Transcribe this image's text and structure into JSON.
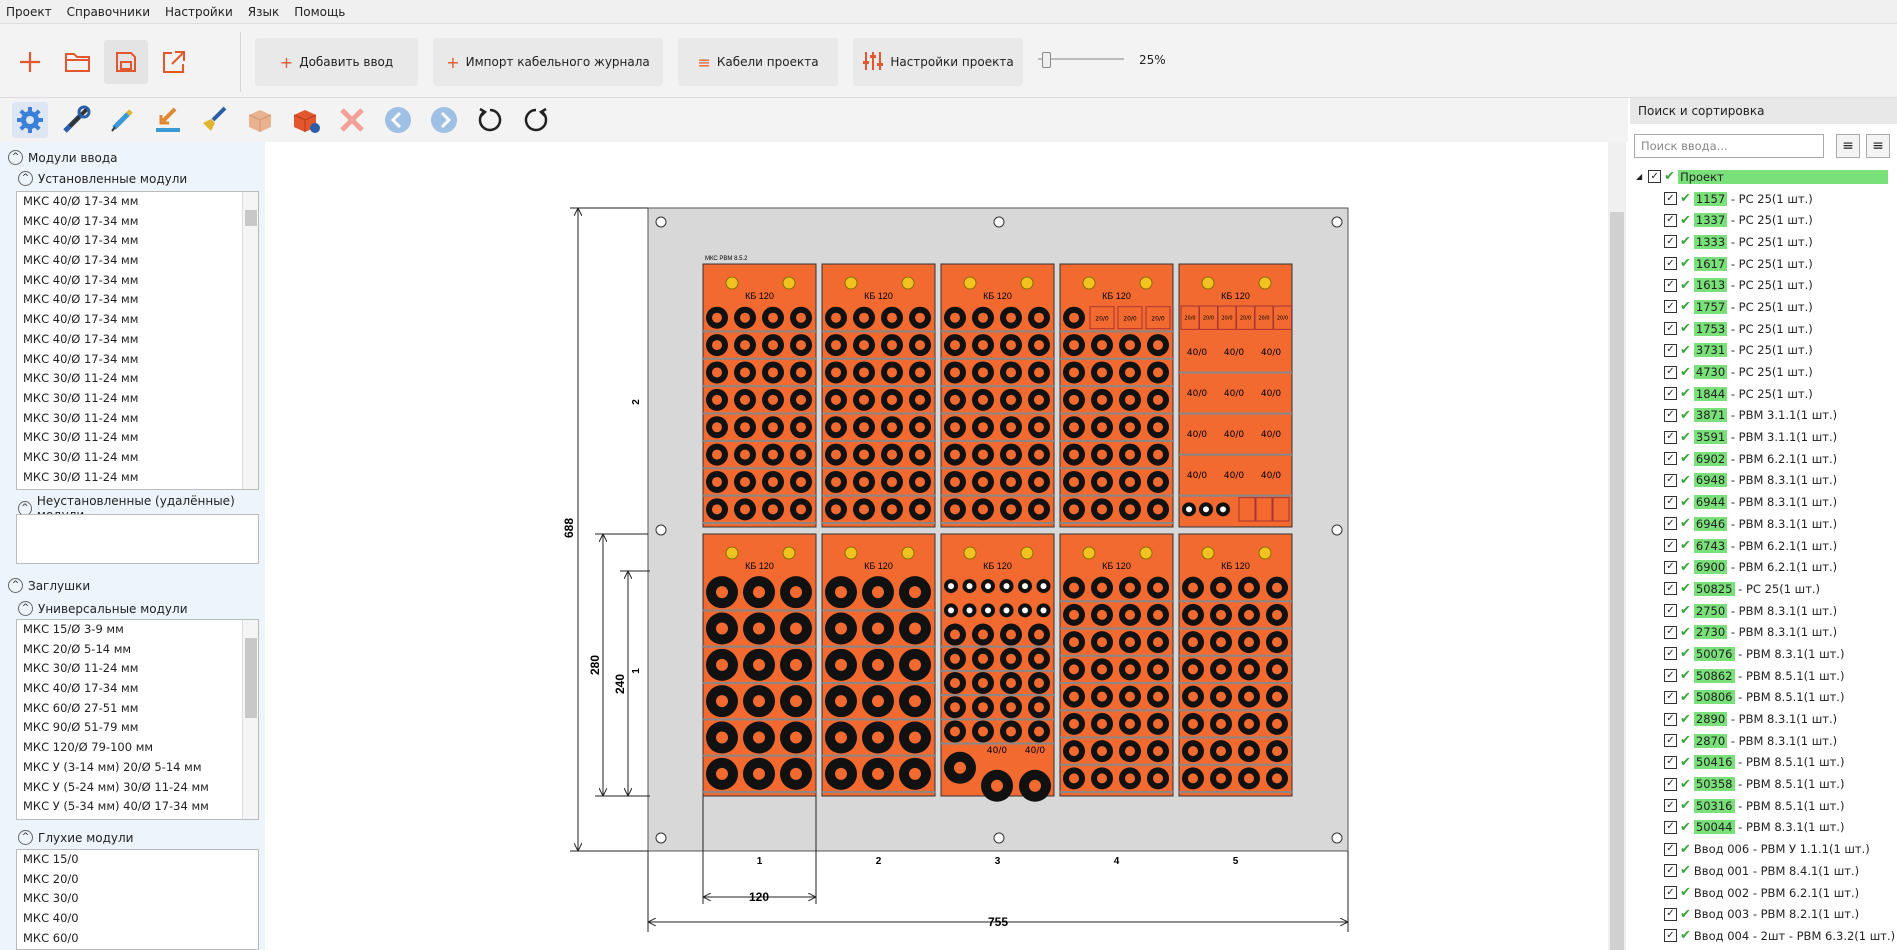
{
  "menu": {
    "items": [
      "Проект",
      "Справочники",
      "Настройки",
      "Язык",
      "Помощь"
    ]
  },
  "ribbon": {
    "add_input": "Добавить ввод",
    "import_journal": "Импорт кабельного журнала",
    "project_cables": "Кабели проекта",
    "project_settings": "Настройки проекта",
    "zoom": "25%",
    "zoom_level_percent": 25
  },
  "left": {
    "input_modules": "Модули ввода",
    "installed_modules": "Установленные модули",
    "installed_items": [
      "МКС 40/Ø 17-34 мм",
      "МКС 40/Ø 17-34 мм",
      "МКС 40/Ø 17-34 мм",
      "МКС 40/Ø 17-34 мм",
      "МКС 40/Ø 17-34 мм",
      "МКС 40/Ø 17-34 мм",
      "МКС 40/Ø 17-34 мм",
      "МКС 40/Ø 17-34 мм",
      "МКС 40/Ø 17-34 мм",
      "МКС 30/Ø 11-24 мм",
      "МКС 30/Ø 11-24 мм",
      "МКС 30/Ø 11-24 мм",
      "МКС 30/Ø 11-24 мм",
      "МКС 30/Ø 11-24 мм",
      "МКС 30/Ø 11-24 мм"
    ],
    "uninstalled_modules": "Неустановленные (удалённые) модули",
    "plugs": "Заглушки",
    "universal_modules": "Универсальные модули",
    "universal_items": [
      "МКС 15/Ø 3-9 мм",
      "МКС 20/Ø 5-14 мм",
      "МКС 30/Ø 11-24 мм",
      "МКС 40/Ø 17-34 мм",
      "МКС 60/Ø 27-51 мм",
      "МКС 90/Ø 51-79 мм",
      "МКС 120/Ø 79-100 мм",
      "МКС У (3-14 мм) 20/Ø 5-14 мм",
      "МКС У (5-24 мм) 30/Ø 11-24 мм",
      "МКС У (5-34 мм) 40/Ø 17-34 мм"
    ],
    "blind_modules": "Глухие модули",
    "blind_items": [
      "МКС 15/0",
      "МКС 20/0",
      "МКС 30/0",
      "МКС 40/0",
      "МКС 60/0"
    ]
  },
  "drawing": {
    "small_label": "МКС РВМ 8.5.2",
    "frame_label": "КБ 120",
    "cell_label": "40/0",
    "tiny_label": "20/0",
    "dim_height": "688",
    "dim_280": "280",
    "dim_240": "240",
    "dim_module_width": "120",
    "dim_width": "755",
    "row_top_label": "2",
    "row_bottom_label": "1",
    "columns": [
      "1",
      "2",
      "3",
      "4",
      "5"
    ]
  },
  "right": {
    "title": "Поиск и сортировка",
    "search_placeholder": "Поиск ввода...",
    "root": "Проект",
    "items": [
      {
        "code": "1157",
        "text": "- РС 25(1 шт.)"
      },
      {
        "code": "1337",
        "text": "- РС 25(1 шт.)"
      },
      {
        "code": "1333",
        "text": "- РС 25(1 шт.)"
      },
      {
        "code": "1617",
        "text": "- РС 25(1 шт.)"
      },
      {
        "code": "1613",
        "text": "- РС 25(1 шт.)"
      },
      {
        "code": "1757",
        "text": "- РС 25(1 шт.)"
      },
      {
        "code": "1753",
        "text": "- РС 25(1 шт.)"
      },
      {
        "code": "3731",
        "text": "- РС 25(1 шт.)"
      },
      {
        "code": "4730",
        "text": "- РС 25(1 шт.)"
      },
      {
        "code": "1844",
        "text": "- РС 25(1 шт.)"
      },
      {
        "code": "3871",
        "text": "- РВМ 3.1.1(1 шт.)"
      },
      {
        "code": "3591",
        "text": "- РВМ 3.1.1(1 шт.)"
      },
      {
        "code": "6902",
        "text": "- РВМ 6.2.1(1 шт.)"
      },
      {
        "code": "6948",
        "text": "- РВМ 8.3.1(1 шт.)"
      },
      {
        "code": "6944",
        "text": "- РВМ 8.3.1(1 шт.)"
      },
      {
        "code": "6946",
        "text": "- РВМ 8.3.1(1 шт.)"
      },
      {
        "code": "6743",
        "text": "- РВМ 6.2.1(1 шт.)"
      },
      {
        "code": "6900",
        "text": "- РВМ 6.2.1(1 шт.)"
      },
      {
        "code": "50825",
        "text": "- РС 25(1 шт.)"
      },
      {
        "code": "2750",
        "text": "- РВМ 8.3.1(1 шт.)"
      },
      {
        "code": "2730",
        "text": "- РВМ 8.3.1(1 шт.)"
      },
      {
        "code": "50076",
        "text": "- РВМ 8.3.1(1 шт.)"
      },
      {
        "code": "50862",
        "text": "- РВМ 8.5.1(1 шт.)"
      },
      {
        "code": "50806",
        "text": "- РВМ 8.5.1(1 шт.)"
      },
      {
        "code": "2890",
        "text": "- РВМ 8.3.1(1 шт.)"
      },
      {
        "code": "2870",
        "text": "- РВМ 8.3.1(1 шт.)"
      },
      {
        "code": "50416",
        "text": "- РВМ 8.5.1(1 шт.)"
      },
      {
        "code": "50358",
        "text": "- РВМ 8.5.1(1 шт.)"
      },
      {
        "code": "50316",
        "text": "- РВМ 8.5.1(1 шт.)"
      },
      {
        "code": "50044",
        "text": "- РВМ 8.3.1(1 шт.)"
      },
      {
        "code": "",
        "text": "Ввод 006 - РВМ У 1.1.1(1 шт.)"
      },
      {
        "code": "",
        "text": "Ввод 001 - РВМ 8.4.1(1 шт.)"
      },
      {
        "code": "",
        "text": "Ввод 002 - РВМ 6.2.1(1 шт.)"
      },
      {
        "code": "",
        "text": "Ввод 003 - РВМ 8.2.1(1 шт.)"
      },
      {
        "code": "",
        "text": "Ввод 004 - 2шт - РВМ 6.3.2(1 шт.)"
      }
    ]
  },
  "colors": {
    "accent": "#e2572d",
    "module": "#f26a30",
    "plate": "#d8d8d8",
    "highlight": "#7ae07a",
    "check": "#3aa53a"
  }
}
